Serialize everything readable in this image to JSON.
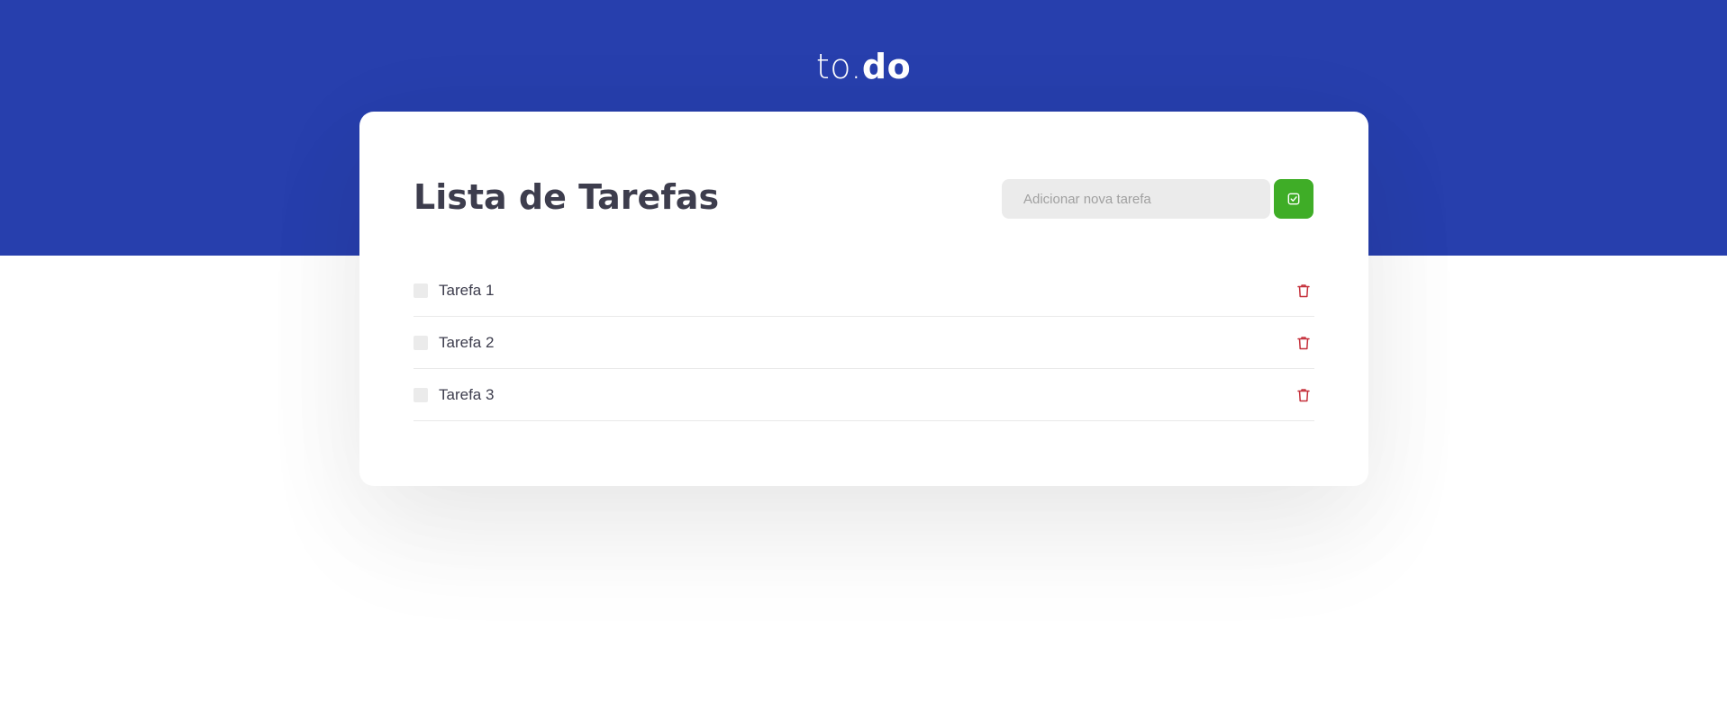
{
  "app": {
    "logo_prefix": "to.",
    "logo_suffix": "do"
  },
  "card": {
    "title": "Lista de Tarefas",
    "new_task": {
      "placeholder": "Adicionar nova tarefa",
      "value": ""
    },
    "add_button_icon": "check-square-icon",
    "delete_icon": "trash-icon"
  },
  "tasks": [
    {
      "label": "Tarefa 1",
      "completed": false
    },
    {
      "label": "Tarefa 2",
      "completed": false
    },
    {
      "label": "Tarefa 3",
      "completed": false
    }
  ],
  "colors": {
    "header_background": "#273fad",
    "add_button": "#3fad27",
    "delete_icon": "#c5303b",
    "title_text": "#3d3d4d",
    "input_background": "#ebebeb"
  }
}
